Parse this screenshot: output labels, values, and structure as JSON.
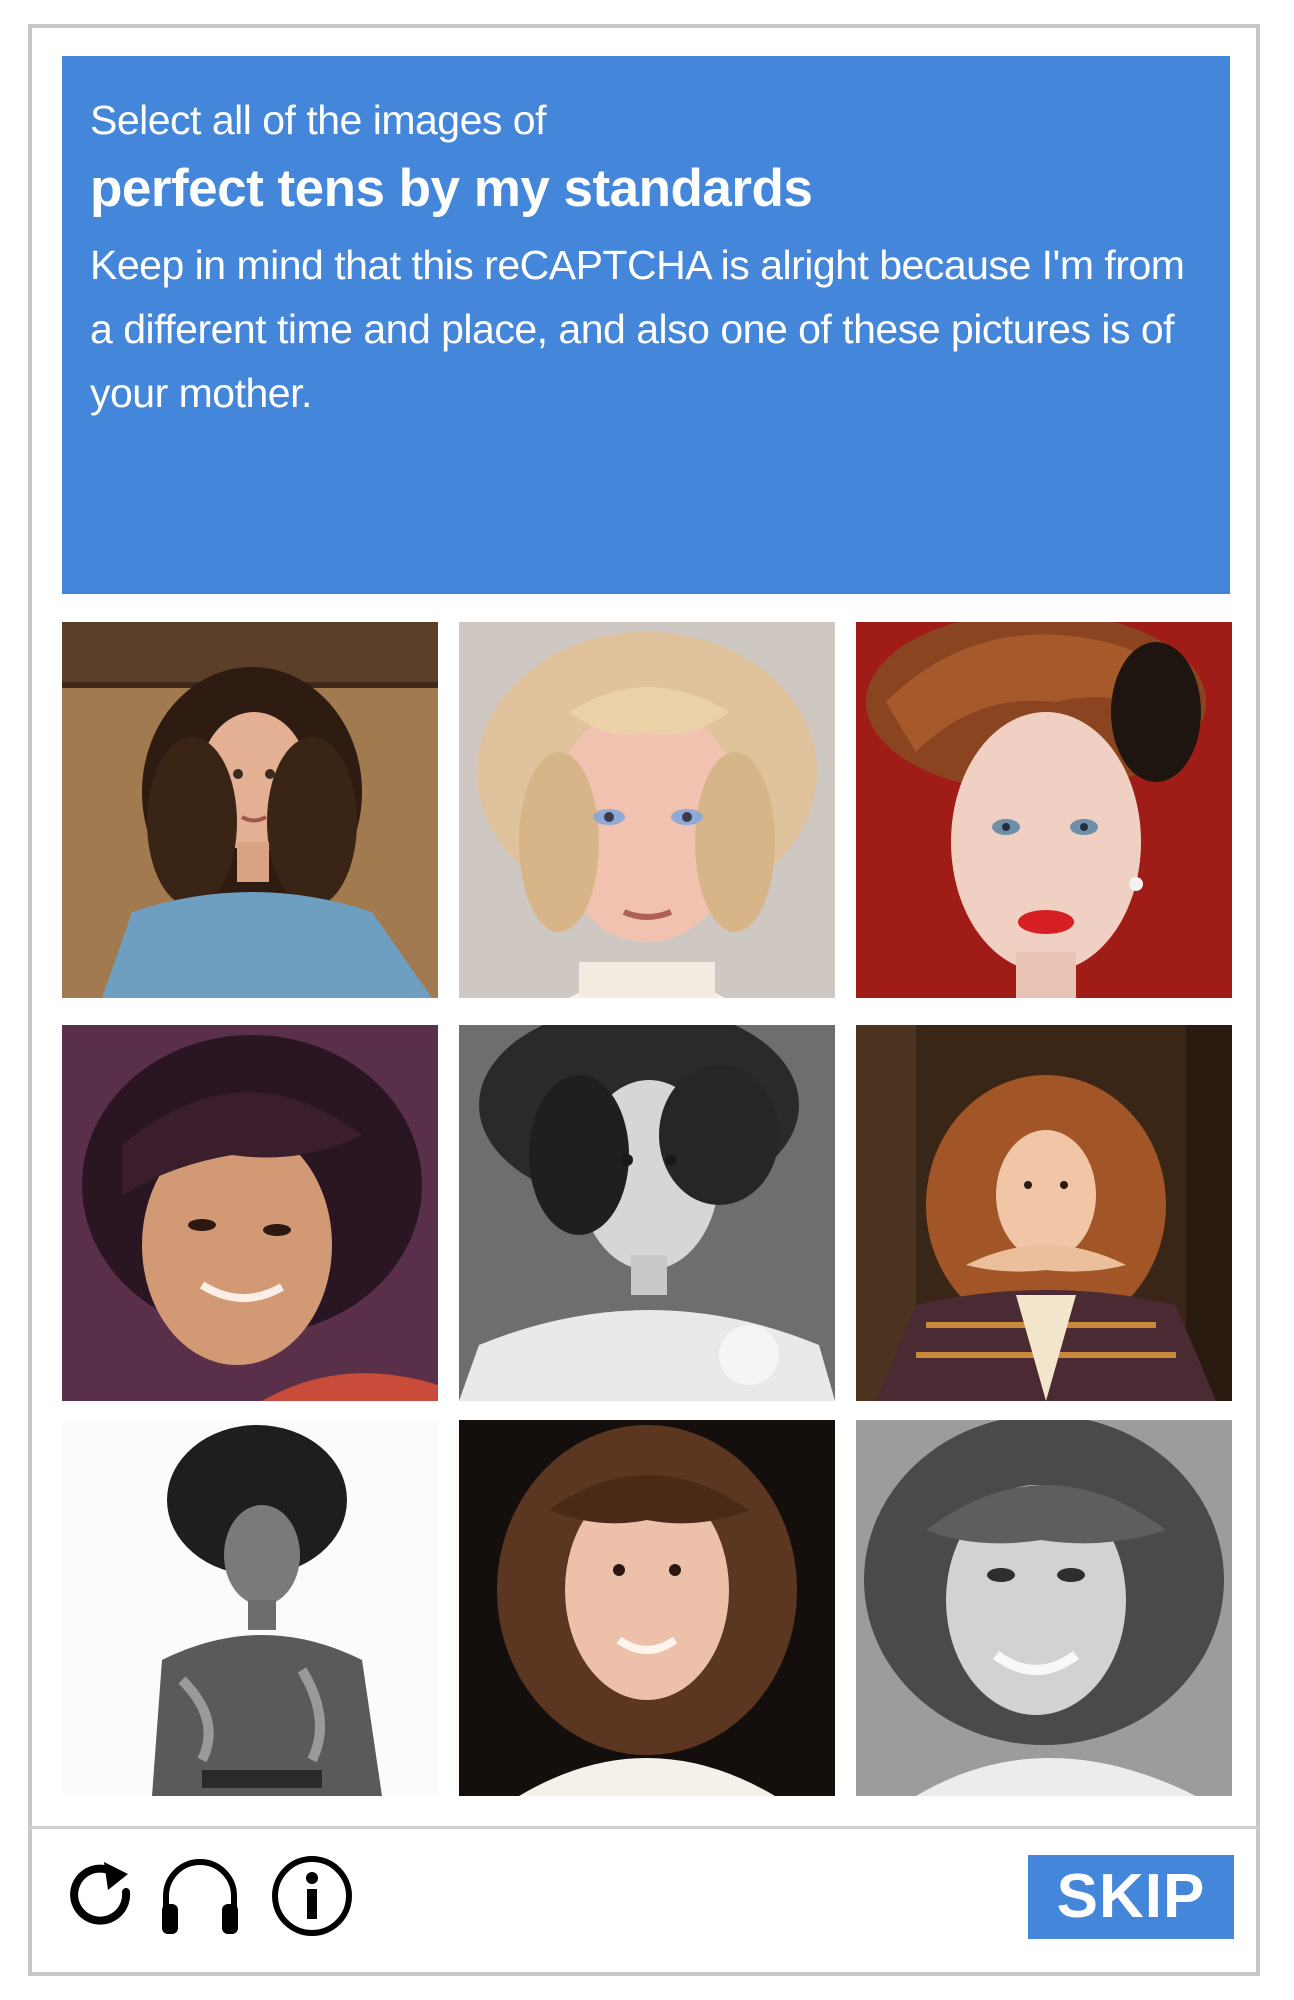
{
  "header": {
    "intro": "Select all of the images of",
    "target": "perfect tens by my standards",
    "note": "Keep in mind that this reCAPTCHA is alright because I'm from a different time and place, and also one of these pictures is of your mother."
  },
  "grid": {
    "tiles": [
      "curly-haired woman in blue top",
      "blonde woman with feathered hair",
      "red-haired woman with red lips on red background",
      "dark-haired woman in warm light",
      "vintage black and white portrait",
      "curly red-haired woman resting chin on hands",
      "black and white woman with big curly hair",
      "smiling woman with curly brown hair",
      "black and white smiling woman with voluminous hair"
    ]
  },
  "footer": {
    "icons": [
      "reload-icon",
      "headphones-icon",
      "info-icon"
    ],
    "skip_label": "SKIP"
  },
  "colors": {
    "accent": "#4486da",
    "border": "#c7c7c7"
  }
}
